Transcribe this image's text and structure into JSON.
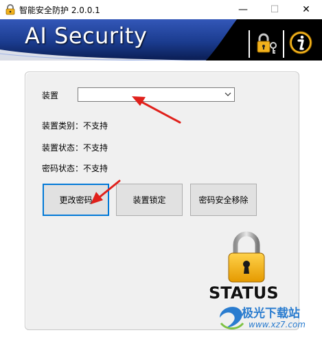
{
  "window": {
    "title": "智能安全防护 2.0.0.1",
    "minimize_glyph": "—",
    "maximize_glyph": "☐",
    "close_glyph": "✕"
  },
  "banner": {
    "title": "AI Security",
    "icons": [
      "lock-key-icon",
      "info-icon"
    ]
  },
  "form": {
    "device_label": "装置",
    "device_value": "",
    "device_type": "装置类别：不支持",
    "device_status": "装置状态：不支持",
    "password_status": "密码状态：不支持"
  },
  "buttons": {
    "change_password": "更改密码",
    "lock_device": "装置锁定",
    "remove_password": "密码安全移除"
  },
  "status": {
    "label": "STATUS",
    "icon": "padlock-icon"
  },
  "watermark": {
    "name": "极光下载站",
    "url": "www.xz7.com"
  },
  "colors": {
    "banner_blue": "#1b3c8f",
    "arrow_red": "#e0201b",
    "lock_gold": "#f2b21c",
    "focus_blue": "#0078d7"
  }
}
